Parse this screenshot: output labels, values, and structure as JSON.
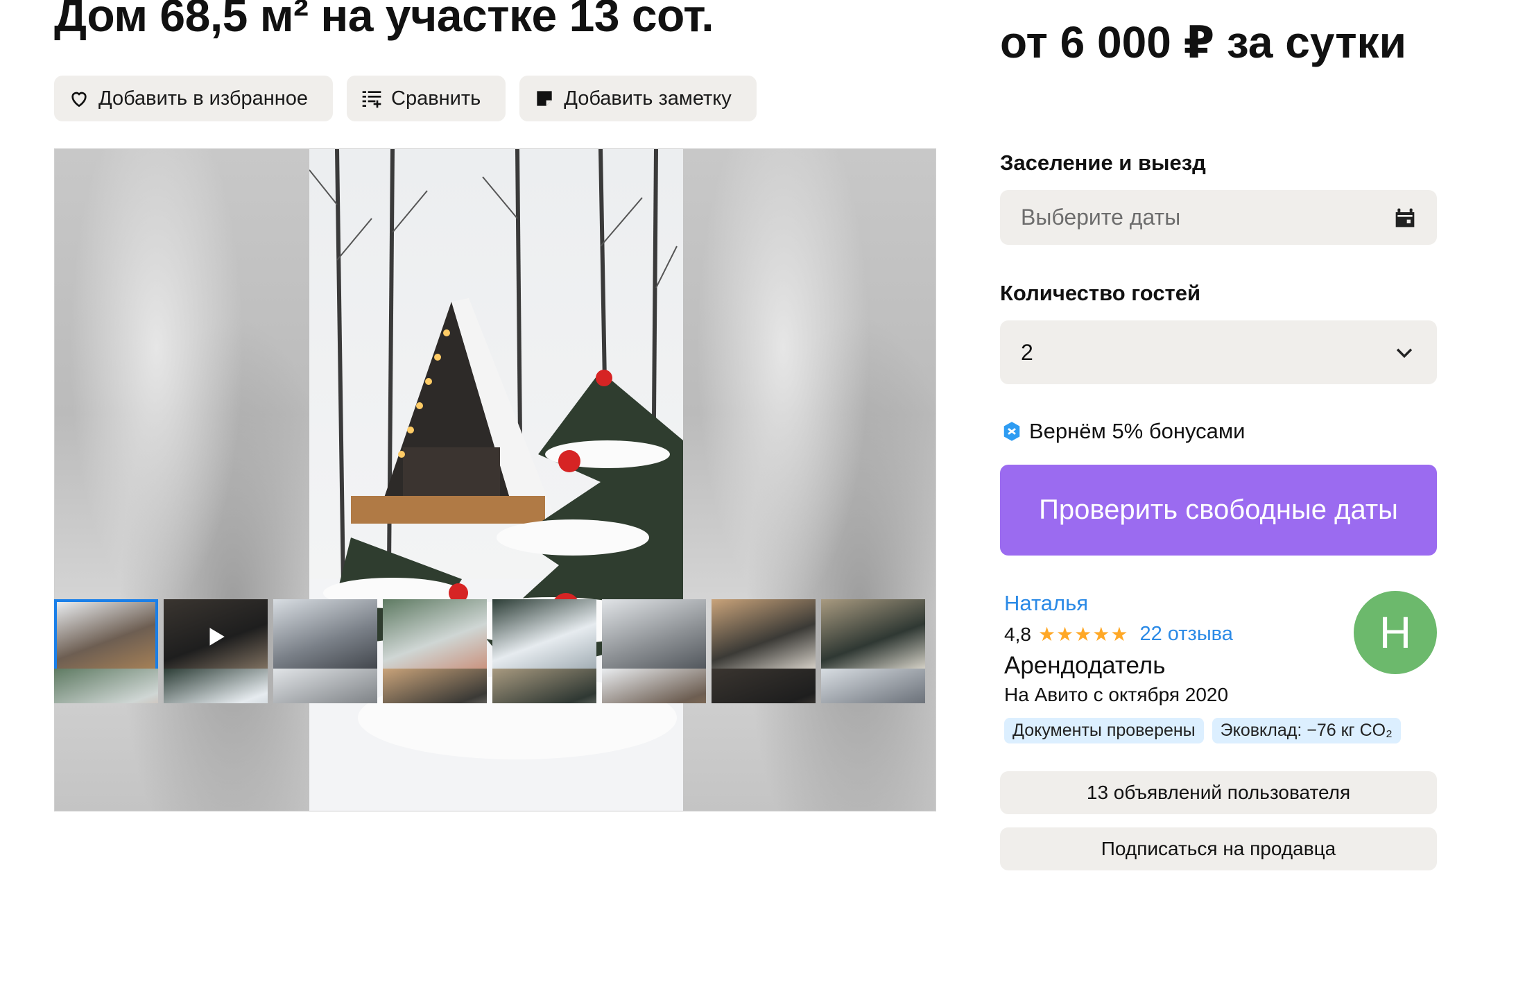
{
  "listing": {
    "title": "Дом 68,5 м² на участке 13 сот.",
    "actions": {
      "favorite": "Добавить в избранное",
      "compare": "Сравнить",
      "note": "Добавить заметку"
    }
  },
  "gallery": {
    "thumbnails_row1": [
      {
        "name": "thumb-1",
        "active": true
      },
      {
        "name": "thumb-2-video",
        "video": true
      },
      {
        "name": "thumb-3"
      },
      {
        "name": "thumb-4"
      },
      {
        "name": "thumb-5"
      },
      {
        "name": "thumb-6"
      },
      {
        "name": "thumb-7"
      },
      {
        "name": "thumb-8"
      }
    ],
    "thumbnails_row2_count": 8,
    "play_icon": "play-icon"
  },
  "booking": {
    "price": "от 6 000 ₽ за сутки",
    "dates_label": "Заселение и выезд",
    "dates_placeholder": "Выберите даты",
    "guests_label": "Количество гостей",
    "guests_value": "2",
    "bonus_text": "Вернём 5% бонусами",
    "check_button": "Проверить свободные даты"
  },
  "seller": {
    "name": "Наталья",
    "rating": "4,8",
    "stars": "★★★★★",
    "reviews": "22 отзыва",
    "role": "Арендодатель",
    "since": "На Авито с октября 2020",
    "avatar_letter": "Н",
    "badges": [
      "Документы проверены",
      "Эковклад: −76 кг CO₂"
    ],
    "listings_button": "13 объявлений пользователя",
    "subscribe_button": "Подписаться на продавца"
  },
  "colors": {
    "accent": "#9b6bf0",
    "link": "#2b8ae6",
    "star": "#ffa826",
    "avatar": "#6cb96c",
    "badge": "#dcefff",
    "button_bg": "#f0eeeb"
  }
}
